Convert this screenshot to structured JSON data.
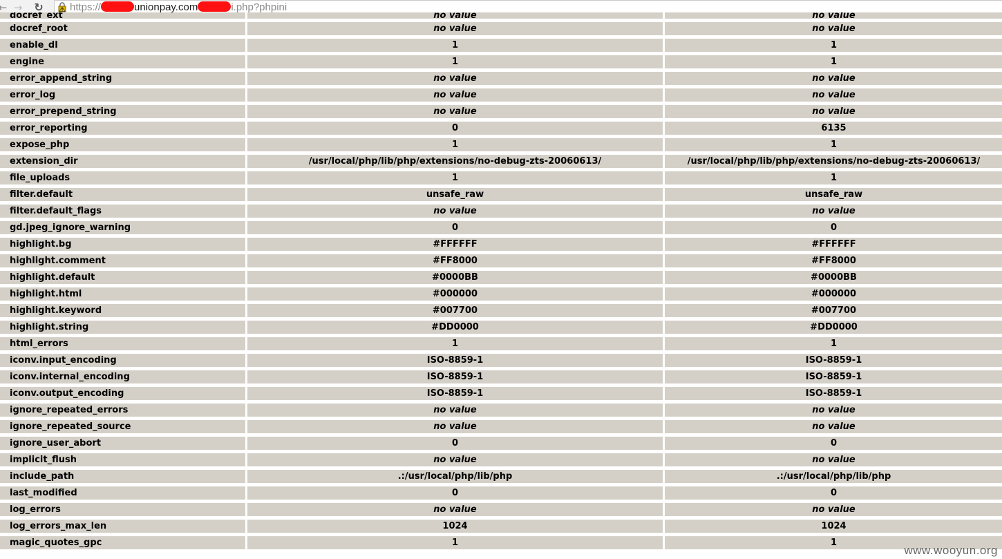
{
  "browser": {
    "url_scheme": "https://",
    "url_host_visible": "unionpay.com",
    "url_path_visible": "i.php?phpini",
    "back_glyph": "←",
    "forward_glyph": "→",
    "reload_glyph": "↻"
  },
  "colors": {
    "row_bg": "#d4d0c8",
    "redaction": "#ff1111"
  },
  "icons": [
    "back-arrow-icon",
    "forward-arrow-icon",
    "reload-icon",
    "warning-lock-icon"
  ],
  "directives": [
    {
      "name": "docref_ext",
      "local": "no value",
      "master": "no value",
      "noval": true
    },
    {
      "name": "docref_root",
      "local": "no value",
      "master": "no value",
      "noval": true
    },
    {
      "name": "enable_dl",
      "local": "1",
      "master": "1"
    },
    {
      "name": "engine",
      "local": "1",
      "master": "1"
    },
    {
      "name": "error_append_string",
      "local": "no value",
      "master": "no value",
      "noval": true
    },
    {
      "name": "error_log",
      "local": "no value",
      "master": "no value",
      "noval": true
    },
    {
      "name": "error_prepend_string",
      "local": "no value",
      "master": "no value",
      "noval": true
    },
    {
      "name": "error_reporting",
      "local": "0",
      "master": "6135"
    },
    {
      "name": "expose_php",
      "local": "1",
      "master": "1"
    },
    {
      "name": "extension_dir",
      "local": "/usr/local/php/lib/php/extensions/no-debug-zts-20060613/",
      "master": "/usr/local/php/lib/php/extensions/no-debug-zts-20060613/"
    },
    {
      "name": "file_uploads",
      "local": "1",
      "master": "1"
    },
    {
      "name": "filter.default",
      "local": "unsafe_raw",
      "master": "unsafe_raw"
    },
    {
      "name": "filter.default_flags",
      "local": "no value",
      "master": "no value",
      "noval": true
    },
    {
      "name": "gd.jpeg_ignore_warning",
      "local": "0",
      "master": "0"
    },
    {
      "name": "highlight.bg",
      "local": "#FFFFFF",
      "master": "#FFFFFF"
    },
    {
      "name": "highlight.comment",
      "local": "#FF8000",
      "master": "#FF8000"
    },
    {
      "name": "highlight.default",
      "local": "#0000BB",
      "master": "#0000BB"
    },
    {
      "name": "highlight.html",
      "local": "#000000",
      "master": "#000000"
    },
    {
      "name": "highlight.keyword",
      "local": "#007700",
      "master": "#007700"
    },
    {
      "name": "highlight.string",
      "local": "#DD0000",
      "master": "#DD0000"
    },
    {
      "name": "html_errors",
      "local": "1",
      "master": "1"
    },
    {
      "name": "iconv.input_encoding",
      "local": "ISO-8859-1",
      "master": "ISO-8859-1"
    },
    {
      "name": "iconv.internal_encoding",
      "local": "ISO-8859-1",
      "master": "ISO-8859-1"
    },
    {
      "name": "iconv.output_encoding",
      "local": "ISO-8859-1",
      "master": "ISO-8859-1"
    },
    {
      "name": "ignore_repeated_errors",
      "local": "no value",
      "master": "no value",
      "noval": true
    },
    {
      "name": "ignore_repeated_source",
      "local": "no value",
      "master": "no value",
      "noval": true
    },
    {
      "name": "ignore_user_abort",
      "local": "0",
      "master": "0"
    },
    {
      "name": "implicit_flush",
      "local": "no value",
      "master": "no value",
      "noval": true
    },
    {
      "name": "include_path",
      "local": ".:/usr/local/php/lib/php",
      "master": ".:/usr/local/php/lib/php"
    },
    {
      "name": "last_modified",
      "local": "0",
      "master": "0"
    },
    {
      "name": "log_errors",
      "local": "no value",
      "master": "no value",
      "noval": true
    },
    {
      "name": "log_errors_max_len",
      "local": "1024",
      "master": "1024"
    },
    {
      "name": "magic_quotes_gpc",
      "local": "1",
      "master": "1"
    }
  ],
  "watermark": "www.wooyun.org"
}
